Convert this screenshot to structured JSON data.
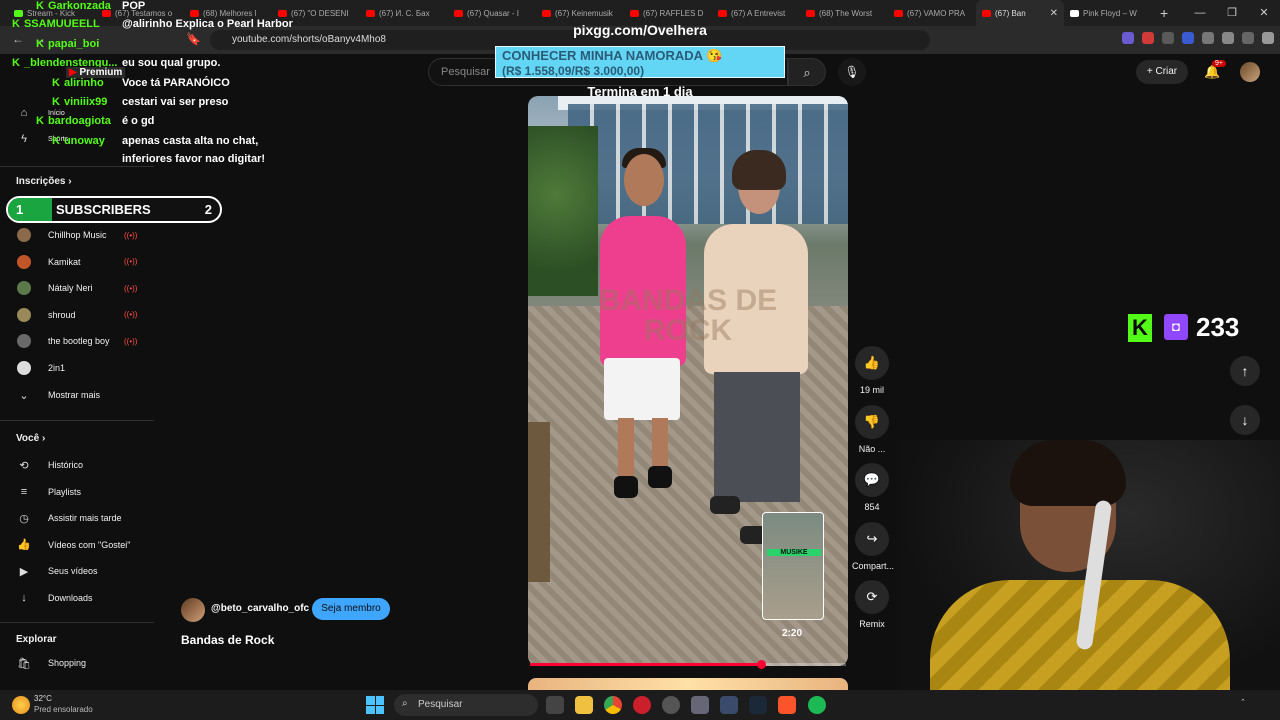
{
  "browser": {
    "tabs": [
      {
        "label": "Stream - Kick"
      },
      {
        "label": "(67) Testamos o"
      },
      {
        "label": "(68) Melhores l"
      },
      {
        "label": "(67) \"O DESENI"
      },
      {
        "label": "(67) И. С. Бах"
      },
      {
        "label": "(67) Quasar - I"
      },
      {
        "label": "(67) Keinemusik"
      },
      {
        "label": "(67) RAFFLES D"
      },
      {
        "label": "(67) A Entrevist"
      },
      {
        "label": "(68) The Worst"
      },
      {
        "label": "(67) VAMO PRA"
      },
      {
        "label": "(67) Ban"
      },
      {
        "label": "Pink Floyd – W"
      }
    ],
    "active_tab_index": 11,
    "url": "youtube.com/shorts/oBanyv4Mho8"
  },
  "youtube": {
    "search_placeholder": "Pesquisar",
    "create_label": "Criar",
    "notifications_badge": "9+"
  },
  "sidebar": {
    "home_label": "Início",
    "shorts_label": "Shorts",
    "subscriptions_heading": "Inscrições",
    "subscriptions": [
      {
        "name": "Chillhop Music",
        "live": "((•))",
        "color": "#8a6a4a"
      },
      {
        "name": "Kamikat",
        "live": "((•))",
        "color": "#c0552a"
      },
      {
        "name": "Nátaly Neri",
        "live": "((•))",
        "color": "#5a7a4a"
      },
      {
        "name": "shroud",
        "live": "((•))",
        "color": "#9a8a5a"
      },
      {
        "name": "the bootleg boy",
        "live": "((•))",
        "color": "#6a6a6a"
      },
      {
        "name": "2in1",
        "live": "",
        "color": "#dddddd"
      }
    ],
    "show_more_label": "Mostrar mais",
    "you_heading": "Você",
    "you_items": [
      {
        "label": "Histórico",
        "icon": "history-icon",
        "glyph": "⟲"
      },
      {
        "label": "Playlists",
        "icon": "playlists-icon",
        "glyph": "≡"
      },
      {
        "label": "Assistir mais tarde",
        "icon": "watch-later-icon",
        "glyph": "◷"
      },
      {
        "label": "Vídeos com \"Gostei\"",
        "icon": "liked-videos-icon",
        "glyph": "👍"
      },
      {
        "label": "Seus vídeos",
        "icon": "your-videos-icon",
        "glyph": "▶"
      },
      {
        "label": "Downloads",
        "icon": "downloads-icon",
        "glyph": "↓"
      }
    ],
    "explore_heading": "Explorar",
    "explore_items": [
      {
        "label": "Shopping",
        "icon": "shopping-icon",
        "glyph": "🛍"
      }
    ]
  },
  "chat": [
    {
      "user": "Garkonzada",
      "message": "POP"
    },
    {
      "user": "SSAMUUEELL",
      "message": "@alirinho Explica o Pearl Harbor"
    },
    {
      "user": "papai_boi",
      "message": ""
    },
    {
      "user": "_blendenstengu...",
      "message": "eu sou qual grupo."
    },
    {
      "user": "alirinho",
      "message": "Voce tá PARANÓICO"
    },
    {
      "user": "viniiix99",
      "message": "cestari vai ser preso"
    },
    {
      "user": "bardoagiota",
      "message": "é o gd"
    },
    {
      "user": "unoway",
      "message": "apenas casta alta no chat,"
    },
    {
      "user": "",
      "message": "inferiores favor nao digitar!"
    }
  ],
  "overlay": {
    "premium_label": "Premium",
    "subscribers": {
      "left": "1",
      "label": "SUBSCRIBERS",
      "right": "2",
      "fill_fraction": 0.5
    },
    "goal_url": "pixgg.com/Ovelhera",
    "goal_title": "CONHECER MINHA NAMORADA 😘",
    "goal_value": "(R$ 1.558,09/R$ 3.000,00)",
    "goal_end": "Termina em 1 dia",
    "kick_count": "233"
  },
  "video": {
    "watermark": "BANDAS DE ROCK",
    "pip_label": "MUSIKE",
    "pip_time": "2:20",
    "progress_fraction": 0.73,
    "channel": "@beto_carvalho_ofc",
    "join_label": "Seja membro",
    "title": "Bandas de Rock",
    "actions": [
      {
        "icon": "like-icon",
        "glyph": "👍",
        "count": "19 mil"
      },
      {
        "icon": "dislike-icon",
        "glyph": "👎",
        "count": "Não ..."
      },
      {
        "icon": "comments-icon",
        "glyph": "💬",
        "count": "854"
      },
      {
        "icon": "share-icon",
        "glyph": "↪",
        "count": "Compart..."
      },
      {
        "icon": "remix-icon",
        "glyph": "⟳",
        "count": "Remix"
      }
    ]
  },
  "taskbar": {
    "temperature": "32°C",
    "condition": "Pred ensolarado",
    "search_placeholder": "Pesquisar"
  },
  "colors": {
    "kick_green": "#53fc18",
    "youtube_red": "#ff0033",
    "join_blue": "#3ea6ff",
    "goal_cyan": "#63d6f5"
  }
}
